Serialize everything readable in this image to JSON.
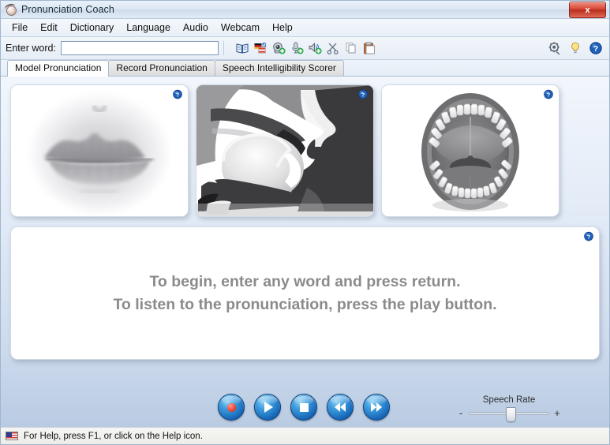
{
  "window": {
    "title": "Pronunciation Coach",
    "app_icon": "head-profile-icon",
    "close_label": "x"
  },
  "menubar": {
    "items": [
      {
        "label": "File"
      },
      {
        "label": "Edit"
      },
      {
        "label": "Dictionary"
      },
      {
        "label": "Language"
      },
      {
        "label": "Audio"
      },
      {
        "label": "Webcam"
      },
      {
        "label": "Help"
      }
    ]
  },
  "toolbar": {
    "enter_word_label": "Enter word:",
    "word_value": "",
    "word_placeholder": "",
    "icons": [
      {
        "name": "dictionary-book-icon"
      },
      {
        "name": "translate-flags-icon"
      },
      {
        "name": "add-webcam-icon"
      },
      {
        "name": "add-microphone-icon"
      },
      {
        "name": "add-speaker-icon"
      },
      {
        "name": "cut-scissors-icon"
      },
      {
        "name": "copy-icon"
      },
      {
        "name": "paste-icon"
      }
    ],
    "right_icons": [
      {
        "name": "webcam-settings-icon"
      },
      {
        "name": "lightbulb-tip-icon"
      },
      {
        "name": "help-question-icon"
      }
    ]
  },
  "tabs": [
    {
      "label": "Model Pronunciation",
      "active": true
    },
    {
      "label": "Record Pronunciation",
      "active": false
    },
    {
      "label": "Speech Intelligibility Scorer",
      "active": false
    }
  ],
  "panels": [
    {
      "name": "lips-front-view-panel",
      "image": "grayscale-photo-of-closed-lips",
      "help": "?"
    },
    {
      "name": "sagittal-vocal-tract-panel",
      "image": "side-cross-section-of-mouth-and-tongue",
      "help": "?"
    },
    {
      "name": "open-mouth-front-panel",
      "image": "open-mouth-with-teeth-palate-and-tongue",
      "help": "?"
    }
  ],
  "prompt": {
    "help": "?",
    "line1": "To begin, enter any word and press return.",
    "line2": "To listen to the pronunciation, press the play button."
  },
  "transport": {
    "buttons": [
      {
        "name": "record-button",
        "glyph": "record"
      },
      {
        "name": "play-button",
        "glyph": "play"
      },
      {
        "name": "stop-button",
        "glyph": "stop"
      },
      {
        "name": "rewind-button",
        "glyph": "rewind"
      },
      {
        "name": "fast-forward-button",
        "glyph": "fast-forward"
      }
    ]
  },
  "speech_rate": {
    "label": "Speech Rate",
    "minus": "-",
    "plus": "+",
    "value_percent": 46
  },
  "statusbar": {
    "flag": "us-flag-icon",
    "text": "For Help, press F1, or click on the Help icon."
  },
  "colors": {
    "accent_blue": "#1767b8",
    "record_red": "#f4483a",
    "close_red": "#d94c3a",
    "prompt_gray": "#8b8b8b"
  }
}
